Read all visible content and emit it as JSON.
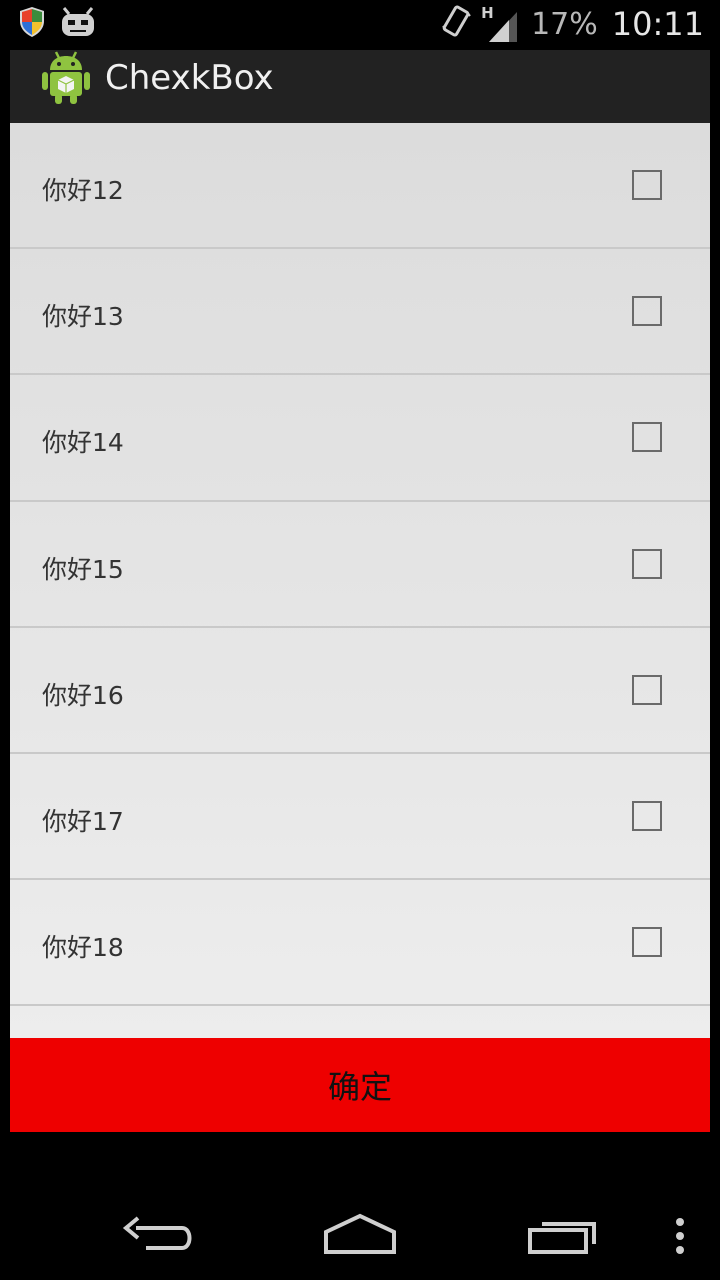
{
  "status_bar": {
    "icons": [
      "shield-icon",
      "android-robot-icon",
      "vibrate-icon",
      "signal-h-icon"
    ],
    "network_type": "H",
    "battery": "17%",
    "time": "10:11"
  },
  "action_bar": {
    "app_icon": "android-app-icon",
    "title": "ChexkBox"
  },
  "list": {
    "items": [
      {
        "label": "你好12",
        "checked": false
      },
      {
        "label": "你好13",
        "checked": false
      },
      {
        "label": "你好14",
        "checked": false
      },
      {
        "label": "你好15",
        "checked": false
      },
      {
        "label": "你好16",
        "checked": false
      },
      {
        "label": "你好17",
        "checked": false
      },
      {
        "label": "你好18",
        "checked": false
      }
    ]
  },
  "confirm_button": {
    "label": "确定",
    "color": "#ee0000"
  },
  "nav_bar": {
    "buttons": [
      "back-icon",
      "home-icon",
      "recents-icon",
      "overflow-menu-icon"
    ]
  }
}
